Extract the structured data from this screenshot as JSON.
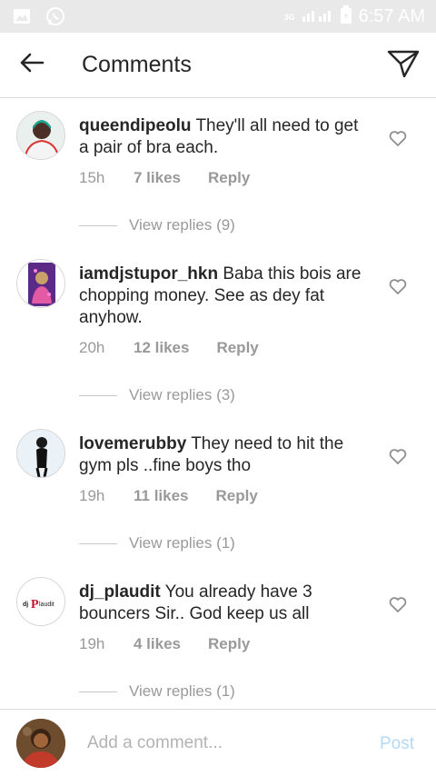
{
  "status_bar": {
    "time": "6:57 AM",
    "network": "3G"
  },
  "header": {
    "title": "Comments"
  },
  "comments": [
    {
      "username": "queendipeolu",
      "text": "They'll all need to get a pair of bra each.",
      "time": "15h",
      "likes": "7 likes",
      "reply": "Reply",
      "view_replies": "View replies (9)"
    },
    {
      "username": "iamdjstupor_hkn",
      "text": "Baba this bois are chopping money. See as dey fat anyhow.",
      "time": "20h",
      "likes": "12 likes",
      "reply": "Reply",
      "view_replies": "View replies (3)"
    },
    {
      "username": "lovemerubby",
      "text": "They need to hit the gym pls ..fine boys tho",
      "time": "19h",
      "likes": "11 likes",
      "reply": "Reply",
      "view_replies": "View replies (1)"
    },
    {
      "username": "dj_plaudit",
      "text": "You already have 3 bouncers Sir.. God keep us all",
      "time": "19h",
      "likes": "4 likes",
      "reply": "Reply",
      "view_replies": "View replies (1)",
      "avatar_logo": "dj plaudit"
    }
  ],
  "footer": {
    "placeholder": "Add a comment...",
    "post_label": "Post"
  },
  "colors": {
    "link_muted": "#999999",
    "post_disabled": "#b3d9f6",
    "status_bar_bg": "#e9e9e9"
  }
}
